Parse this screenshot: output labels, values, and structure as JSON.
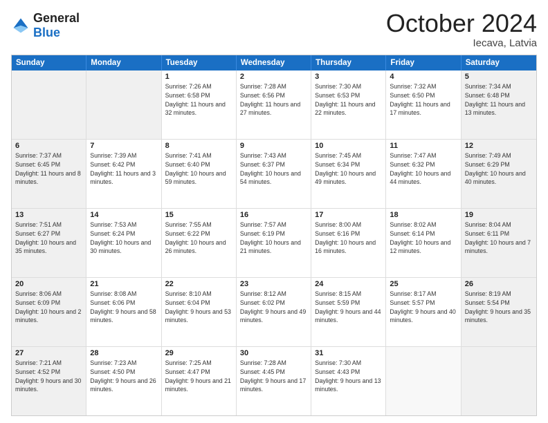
{
  "logo": {
    "line1": "General",
    "line2": "Blue"
  },
  "header": {
    "month": "October 2024",
    "location": "Iecava, Latvia"
  },
  "weekdays": [
    "Sunday",
    "Monday",
    "Tuesday",
    "Wednesday",
    "Thursday",
    "Friday",
    "Saturday"
  ],
  "weeks": [
    [
      {
        "day": "",
        "sunrise": "",
        "sunset": "",
        "daylight": "",
        "shaded": true
      },
      {
        "day": "",
        "sunrise": "",
        "sunset": "",
        "daylight": "",
        "shaded": true
      },
      {
        "day": "1",
        "sunrise": "Sunrise: 7:26 AM",
        "sunset": "Sunset: 6:58 PM",
        "daylight": "Daylight: 11 hours and 32 minutes.",
        "shaded": false
      },
      {
        "day": "2",
        "sunrise": "Sunrise: 7:28 AM",
        "sunset": "Sunset: 6:56 PM",
        "daylight": "Daylight: 11 hours and 27 minutes.",
        "shaded": false
      },
      {
        "day": "3",
        "sunrise": "Sunrise: 7:30 AM",
        "sunset": "Sunset: 6:53 PM",
        "daylight": "Daylight: 11 hours and 22 minutes.",
        "shaded": false
      },
      {
        "day": "4",
        "sunrise": "Sunrise: 7:32 AM",
        "sunset": "Sunset: 6:50 PM",
        "daylight": "Daylight: 11 hours and 17 minutes.",
        "shaded": false
      },
      {
        "day": "5",
        "sunrise": "Sunrise: 7:34 AM",
        "sunset": "Sunset: 6:48 PM",
        "daylight": "Daylight: 11 hours and 13 minutes.",
        "shaded": true
      }
    ],
    [
      {
        "day": "6",
        "sunrise": "Sunrise: 7:37 AM",
        "sunset": "Sunset: 6:45 PM",
        "daylight": "Daylight: 11 hours and 8 minutes.",
        "shaded": true
      },
      {
        "day": "7",
        "sunrise": "Sunrise: 7:39 AM",
        "sunset": "Sunset: 6:42 PM",
        "daylight": "Daylight: 11 hours and 3 minutes.",
        "shaded": false
      },
      {
        "day": "8",
        "sunrise": "Sunrise: 7:41 AM",
        "sunset": "Sunset: 6:40 PM",
        "daylight": "Daylight: 10 hours and 59 minutes.",
        "shaded": false
      },
      {
        "day": "9",
        "sunrise": "Sunrise: 7:43 AM",
        "sunset": "Sunset: 6:37 PM",
        "daylight": "Daylight: 10 hours and 54 minutes.",
        "shaded": false
      },
      {
        "day": "10",
        "sunrise": "Sunrise: 7:45 AM",
        "sunset": "Sunset: 6:34 PM",
        "daylight": "Daylight: 10 hours and 49 minutes.",
        "shaded": false
      },
      {
        "day": "11",
        "sunrise": "Sunrise: 7:47 AM",
        "sunset": "Sunset: 6:32 PM",
        "daylight": "Daylight: 10 hours and 44 minutes.",
        "shaded": false
      },
      {
        "day": "12",
        "sunrise": "Sunrise: 7:49 AM",
        "sunset": "Sunset: 6:29 PM",
        "daylight": "Daylight: 10 hours and 40 minutes.",
        "shaded": true
      }
    ],
    [
      {
        "day": "13",
        "sunrise": "Sunrise: 7:51 AM",
        "sunset": "Sunset: 6:27 PM",
        "daylight": "Daylight: 10 hours and 35 minutes.",
        "shaded": true
      },
      {
        "day": "14",
        "sunrise": "Sunrise: 7:53 AM",
        "sunset": "Sunset: 6:24 PM",
        "daylight": "Daylight: 10 hours and 30 minutes.",
        "shaded": false
      },
      {
        "day": "15",
        "sunrise": "Sunrise: 7:55 AM",
        "sunset": "Sunset: 6:22 PM",
        "daylight": "Daylight: 10 hours and 26 minutes.",
        "shaded": false
      },
      {
        "day": "16",
        "sunrise": "Sunrise: 7:57 AM",
        "sunset": "Sunset: 6:19 PM",
        "daylight": "Daylight: 10 hours and 21 minutes.",
        "shaded": false
      },
      {
        "day": "17",
        "sunrise": "Sunrise: 8:00 AM",
        "sunset": "Sunset: 6:16 PM",
        "daylight": "Daylight: 10 hours and 16 minutes.",
        "shaded": false
      },
      {
        "day": "18",
        "sunrise": "Sunrise: 8:02 AM",
        "sunset": "Sunset: 6:14 PM",
        "daylight": "Daylight: 10 hours and 12 minutes.",
        "shaded": false
      },
      {
        "day": "19",
        "sunrise": "Sunrise: 8:04 AM",
        "sunset": "Sunset: 6:11 PM",
        "daylight": "Daylight: 10 hours and 7 minutes.",
        "shaded": true
      }
    ],
    [
      {
        "day": "20",
        "sunrise": "Sunrise: 8:06 AM",
        "sunset": "Sunset: 6:09 PM",
        "daylight": "Daylight: 10 hours and 2 minutes.",
        "shaded": true
      },
      {
        "day": "21",
        "sunrise": "Sunrise: 8:08 AM",
        "sunset": "Sunset: 6:06 PM",
        "daylight": "Daylight: 9 hours and 58 minutes.",
        "shaded": false
      },
      {
        "day": "22",
        "sunrise": "Sunrise: 8:10 AM",
        "sunset": "Sunset: 6:04 PM",
        "daylight": "Daylight: 9 hours and 53 minutes.",
        "shaded": false
      },
      {
        "day": "23",
        "sunrise": "Sunrise: 8:12 AM",
        "sunset": "Sunset: 6:02 PM",
        "daylight": "Daylight: 9 hours and 49 minutes.",
        "shaded": false
      },
      {
        "day": "24",
        "sunrise": "Sunrise: 8:15 AM",
        "sunset": "Sunset: 5:59 PM",
        "daylight": "Daylight: 9 hours and 44 minutes.",
        "shaded": false
      },
      {
        "day": "25",
        "sunrise": "Sunrise: 8:17 AM",
        "sunset": "Sunset: 5:57 PM",
        "daylight": "Daylight: 9 hours and 40 minutes.",
        "shaded": false
      },
      {
        "day": "26",
        "sunrise": "Sunrise: 8:19 AM",
        "sunset": "Sunset: 5:54 PM",
        "daylight": "Daylight: 9 hours and 35 minutes.",
        "shaded": true
      }
    ],
    [
      {
        "day": "27",
        "sunrise": "Sunrise: 7:21 AM",
        "sunset": "Sunset: 4:52 PM",
        "daylight": "Daylight: 9 hours and 30 minutes.",
        "shaded": true
      },
      {
        "day": "28",
        "sunrise": "Sunrise: 7:23 AM",
        "sunset": "Sunset: 4:50 PM",
        "daylight": "Daylight: 9 hours and 26 minutes.",
        "shaded": false
      },
      {
        "day": "29",
        "sunrise": "Sunrise: 7:25 AM",
        "sunset": "Sunset: 4:47 PM",
        "daylight": "Daylight: 9 hours and 21 minutes.",
        "shaded": false
      },
      {
        "day": "30",
        "sunrise": "Sunrise: 7:28 AM",
        "sunset": "Sunset: 4:45 PM",
        "daylight": "Daylight: 9 hours and 17 minutes.",
        "shaded": false
      },
      {
        "day": "31",
        "sunrise": "Sunrise: 7:30 AM",
        "sunset": "Sunset: 4:43 PM",
        "daylight": "Daylight: 9 hours and 13 minutes.",
        "shaded": false
      },
      {
        "day": "",
        "sunrise": "",
        "sunset": "",
        "daylight": "",
        "shaded": false
      },
      {
        "day": "",
        "sunrise": "",
        "sunset": "",
        "daylight": "",
        "shaded": true
      }
    ]
  ]
}
